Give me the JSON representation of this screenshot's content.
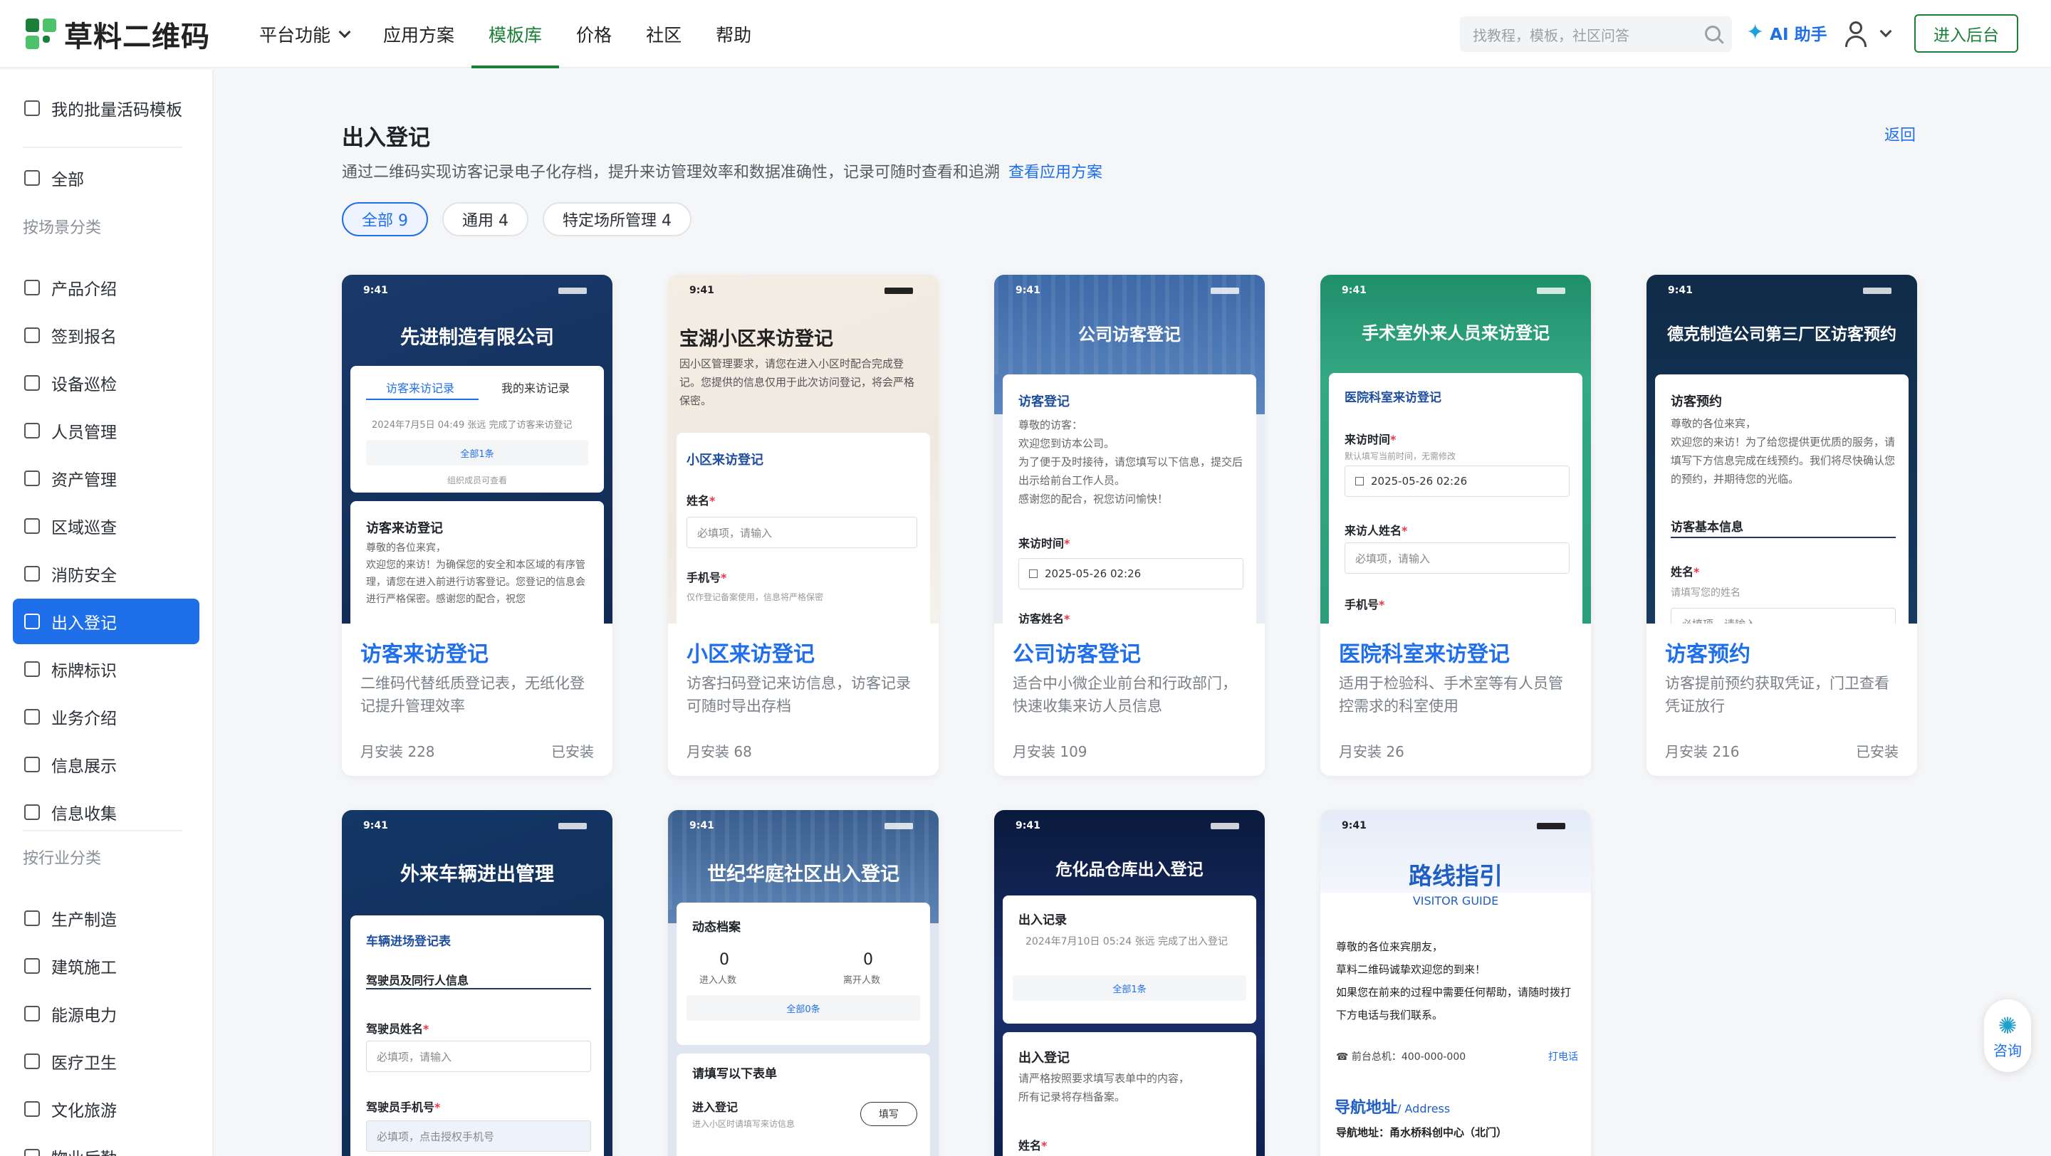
{
  "brand": {
    "logo_text": "草料二维码",
    "logo_icon": "qr-logo-icon",
    "accent": "#1f6feb",
    "green": "#1a7f37"
  },
  "nav": {
    "items": [
      "平台功能",
      "应用方案",
      "模板库",
      "价格",
      "社区",
      "帮助"
    ],
    "active": "模板库"
  },
  "header": {
    "search_placeholder": "找教程，模板，社区问答",
    "ai": "AI 助手",
    "admin": "进入后台"
  },
  "sidebar": {
    "top": "我的批量活码模板",
    "all": "全部",
    "group1": "按场景分类",
    "scenes": [
      "产品介绍",
      "签到报名",
      "设备巡检",
      "人员管理",
      "资产管理",
      "区域巡查",
      "消防安全",
      "出入登记",
      "标牌标识",
      "业务介绍",
      "信息展示",
      "信息收集"
    ],
    "active": "出入登记",
    "group2": "按行业分类",
    "industries": [
      "生产制造",
      "建筑施工",
      "能源电力",
      "医疗卫生",
      "文化旅游",
      "物业后勤"
    ]
  },
  "page": {
    "title": "出入登记",
    "back": "返回",
    "desc": "通过二维码实现访客记录电子化存档，提升来访管理效率和数据准确性，记录可随时查看和追溯",
    "desc_link": "查看应用方案",
    "tabs": [
      {
        "label": "全部 9"
      },
      {
        "label": "通用 4"
      },
      {
        "label": "特定场所管理 4"
      }
    ]
  },
  "cards": [
    {
      "title": "访客来访登记",
      "desc": "二维码代替纸质登记表，无纸化登记提升管理效率",
      "stats": "月安装   228",
      "installed": "已安装",
      "p": {
        "time": "9:41",
        "hero": "先进制造有限公司",
        "tab1": "访客来访记录",
        "tab2": "我的来访记录",
        "log": "2024年7月5日 04:49 张远 完成了访客来访登记",
        "all": "全部1条",
        "note": "组织成员可查看",
        "sec": "访客来访登记",
        "text": "尊敬的各位来宾，\n欢迎您的来访！为确保您的安全和本区域的有序管理，请您在进入前进行访客登记。您登记的信息会进行严格保密。感谢您的配合，祝您"
      }
    },
    {
      "title": "小区来访登记",
      "desc": "访客扫码登记来访信息，访客记录可随时导出存档",
      "stats": "月安装   68",
      "installed": "",
      "p": {
        "time": "9:41",
        "hero": "宝湖小区来访登记",
        "text": "因小区管理要求，请您在进入小区时配合完成登记。您提供的信息仅用于此次访问登记，将会严格保密。",
        "sec": "小区来访登记",
        "f1": "姓名",
        "f1ph": "必填项，请输入",
        "f2": "手机号",
        "f2ph": "仅作登记备案使用，信息将严格保密"
      }
    },
    {
      "title": "公司访客登记",
      "desc": "适合中小微企业前台和行政部门，快速收集来访人员信息",
      "stats": "月安装   109",
      "installed": "",
      "p": {
        "time": "9:41",
        "hero": "公司访客登记",
        "sec": "访客登记",
        "text": "尊敬的访客：\n欢迎您到访本公司。\n为了便于及时接待，请您填写以下信息，提交后出示给前台工作人员。\n感谢您的配合，祝您访问愉快！",
        "f1": "来访时间",
        "f1v": "2025-05-26 02:26",
        "f2": "访客姓名"
      }
    },
    {
      "title": "医院科室来访登记",
      "desc": "适用于检验科、手术室等有人员管控需求的科室使用",
      "stats": "月安装   26",
      "installed": "",
      "p": {
        "time": "9:41",
        "hero": "手术室外来人员来访登记",
        "sec": "医院科室来访登记",
        "f1": "来访时间",
        "f1hint": "默认填写当前时间，无需修改",
        "f1v": "2025-05-26 02:26",
        "f2": "来访人姓名",
        "f2ph": "必填项，请输入",
        "f3": "手机号"
      }
    },
    {
      "title": "访客预约",
      "desc": "访客提前预约获取凭证，门卫查看凭证放行",
      "stats": "月安装   216",
      "installed": "已安装",
      "p": {
        "time": "9:41",
        "hero": "德克制造公司第三厂区访客预约",
        "sec": "访客预约",
        "text": "尊敬的各位来宾，\n欢迎您的来访！为了给您提供更优质的服务，请填写下方信息完成在线预约。我们将尽快确认您的预约，并期待您的光临。",
        "sub": "访客基本信息",
        "f1": "姓名",
        "f1ph": "请填写您的姓名",
        "f1ph2": "必填项，请输入"
      }
    },
    {
      "p": {
        "time": "9:41",
        "hero": "外来车辆进出管理",
        "sec": "车辆进场登记表",
        "sub": "驾驶员及同行人信息",
        "f1": "驾驶员姓名",
        "f1ph": "必填项，请输入",
        "f2": "驾驶员手机号",
        "f2ph": "必填项，点击授权手机号"
      }
    },
    {
      "p": {
        "time": "9:41",
        "hero": "世纪华庭社区出入登记",
        "sec": "动态档案",
        "n1": "0",
        "l1": "进入人数",
        "n2": "0",
        "l2": "离开人数",
        "all": "全部0条",
        "sec2": "请填写以下表单",
        "row": "进入登记",
        "rowsub": "进入小区时请填写来访信息",
        "btn": "填写"
      }
    },
    {
      "p": {
        "time": "9:41",
        "hero": "危化品仓库出入登记",
        "sec": "出入记录",
        "log": "2024年7月10日 05:24 张远 完成了出入登记",
        "all": "全部1条",
        "sec2": "出入登记",
        "text": "请严格按照要求填写表单中的内容，\n所有记录将存档备案。",
        "f1": "姓名"
      }
    },
    {
      "p": {
        "time": "9:41",
        "hero": "路线指引",
        "hero_sub": "VISITOR GUIDE",
        "text": "尊敬的各位来宾朋友，\n草料二维码诚挚欢迎您的到来！\n如果您在前来的过程中需要任何帮助，请随时拨打下方电话与我们联系。",
        "phone": "前台总机：400-000-000",
        "call": "打电话",
        "nav_title": "导航地址",
        "nav_sub": "/ Address",
        "addr": "导航地址：甬水桥科创中心（北门）"
      }
    }
  ],
  "consult": "咨询"
}
